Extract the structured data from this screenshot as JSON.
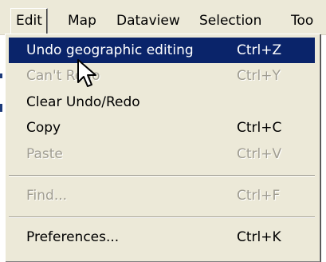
{
  "menubar": {
    "items": [
      {
        "label": "Edit"
      },
      {
        "label": "Map"
      },
      {
        "label": "Dataview"
      },
      {
        "label": "Selection"
      },
      {
        "label": "Too"
      }
    ]
  },
  "edit_menu": {
    "items": [
      {
        "label": "Undo geographic editing",
        "shortcut": "Ctrl+Z",
        "state": "highlighted"
      },
      {
        "label": "Can't Redo",
        "shortcut": "Ctrl+Y",
        "state": "disabled"
      },
      {
        "label": "Clear Undo/Redo",
        "shortcut": "",
        "state": "enabled"
      },
      {
        "label": "Copy",
        "shortcut": "Ctrl+C",
        "state": "enabled"
      },
      {
        "label": "Paste",
        "shortcut": "Ctrl+V",
        "state": "disabled"
      },
      {
        "label": "Find...",
        "shortcut": "Ctrl+F",
        "state": "disabled"
      },
      {
        "label": "Preferences...",
        "shortcut": "Ctrl+K",
        "state": "enabled"
      }
    ]
  },
  "colors": {
    "menu_bg": "#ece9d8",
    "highlight_bg": "#0a246a",
    "highlight_text": "#ffffff",
    "disabled_text": "#a09d91"
  },
  "icons": {
    "cursor": "arrow-cursor-icon"
  }
}
